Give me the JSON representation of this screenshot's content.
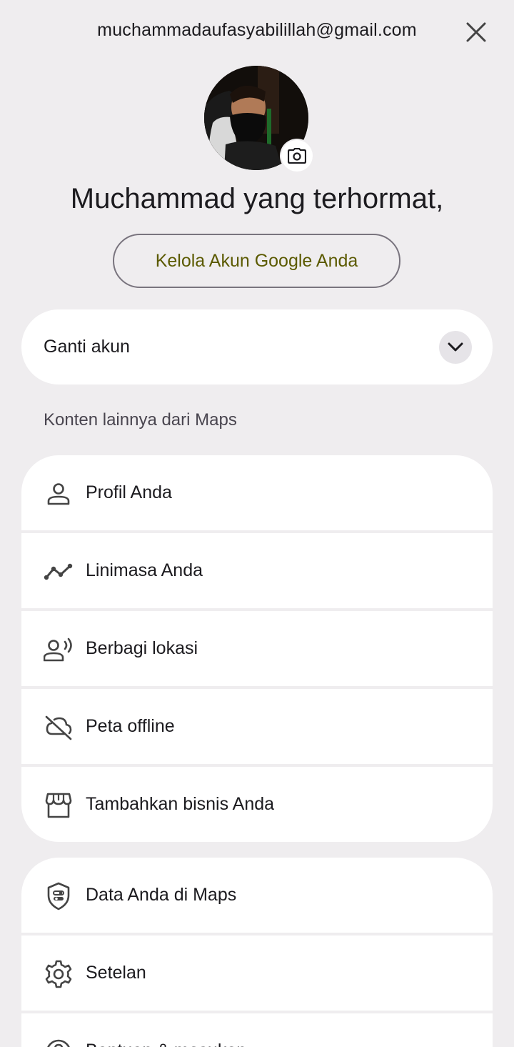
{
  "account": {
    "email": "muchammadaufasyabilillah@gmail.com",
    "greeting": "Muchammad yang terhormat,",
    "manage_label": "Kelola Akun Google Anda"
  },
  "switch_account": {
    "label": "Ganti akun"
  },
  "section": {
    "title": "Konten lainnya dari Maps"
  },
  "menu_group_1": [
    {
      "label": "Profil Anda",
      "icon": "person-icon"
    },
    {
      "label": "Linimasa Anda",
      "icon": "timeline-icon"
    },
    {
      "label": "Berbagi lokasi",
      "icon": "location-sharing-icon"
    },
    {
      "label": "Peta offline",
      "icon": "cloud-off-icon"
    },
    {
      "label": "Tambahkan bisnis Anda",
      "icon": "storefront-icon"
    }
  ],
  "menu_group_2": [
    {
      "label": "Data Anda di Maps",
      "icon": "shield-icon"
    },
    {
      "label": "Setelan",
      "icon": "gear-icon"
    },
    {
      "label": "Bantuan & masukan",
      "icon": "help-icon"
    }
  ],
  "colors": {
    "background": "#efedef",
    "surface": "#ffffff",
    "accent_text": "#5b5a00",
    "text": "#1c1b1f"
  }
}
